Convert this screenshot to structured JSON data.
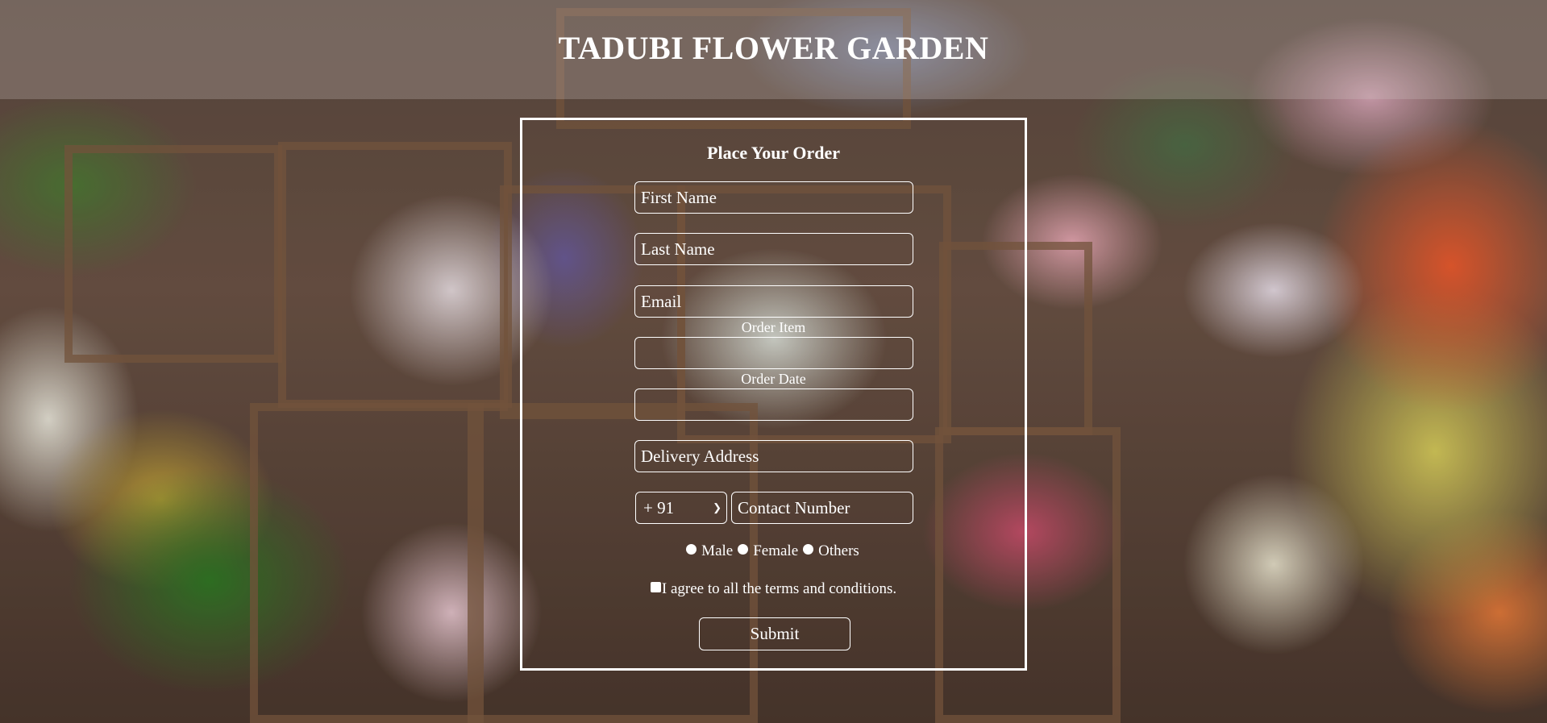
{
  "header": {
    "title": "TADUBI FLOWER GARDEN"
  },
  "form": {
    "heading": "Place Your Order",
    "first_name_placeholder": "First Name",
    "last_name_placeholder": "Last Name",
    "email_placeholder": "Email",
    "order_item_label": "Order Item",
    "order_item_value": "",
    "order_date_label": "Order Date",
    "order_date_value": "",
    "delivery_address_placeholder": "Delivery Address",
    "country_code": "+ 91",
    "contact_number_placeholder": "Contact Number",
    "gender_options": [
      "Male",
      "Female",
      "Others"
    ],
    "terms_label": "I agree to all the terms and conditions.",
    "submit_label": "Submit"
  },
  "icons": {
    "country_code_dropdown": "chevron-down-icon"
  },
  "colors": {
    "text": "#ffffff",
    "border": "#ffffff"
  }
}
